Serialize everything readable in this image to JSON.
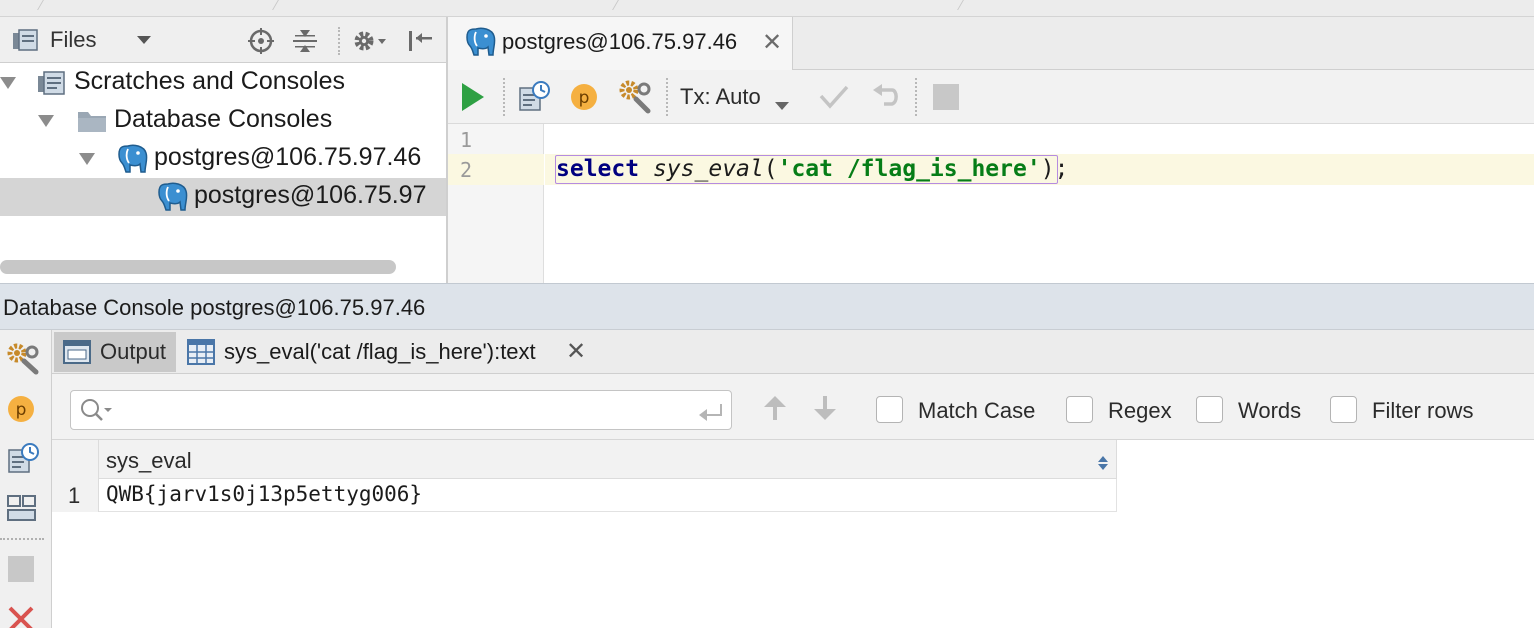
{
  "project_panel": {
    "view_label": "Files",
    "tree": [
      {
        "label": "Scratches and Consoles",
        "icon": "scratches-icon",
        "expanded": true
      },
      {
        "label": "Database Consoles",
        "icon": "folder-icon",
        "expanded": true
      },
      {
        "label": "postgres@106.75.97.46",
        "icon": "postgres-elephant-icon",
        "expanded": true
      },
      {
        "label": "postgres@106.75.97",
        "icon": "postgres-elephant-icon",
        "selected": true
      }
    ]
  },
  "editor": {
    "tab_label": "postgres@106.75.97.46",
    "toolbar": {
      "tx_label": "Tx: Auto"
    },
    "line_numbers": [
      "1",
      "2"
    ],
    "code": {
      "keyword": "select",
      "function": "sys_eval",
      "open_paren": "(",
      "string": "'cat /flag_is_here'",
      "close_paren": ")",
      "semicolon": ";"
    }
  },
  "console": {
    "title": "Database Console postgres@106.75.97.46",
    "tabs": {
      "output_label": "Output",
      "result_label": "sys_eval('cat /flag_is_here'):text"
    },
    "search": {
      "placeholder": "",
      "options": [
        "Match Case",
        "Regex",
        "Words",
        "Filter rows"
      ]
    },
    "grid": {
      "columns": [
        "sys_eval"
      ],
      "rows": [
        {
          "num": "1",
          "values": [
            "QWB{jarv1s0j13p5ettyg006}"
          ]
        }
      ]
    }
  },
  "colors": {
    "accent_green": "#2ea043",
    "keyword_navy": "#000080",
    "string_green": "#067d17",
    "postgres_blue": "#336791",
    "close_red": "#d9534f"
  }
}
